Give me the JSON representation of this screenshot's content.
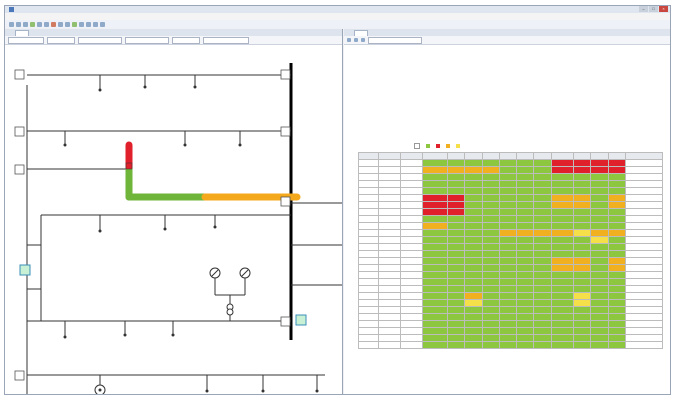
{
  "window": {
    "title": "",
    "buttons": [
      "–",
      "□",
      "×"
    ]
  },
  "menu": [],
  "colors": {
    "ok": "#8dc63f",
    "overload": "#e0202a",
    "warning": "#f5e04a",
    "caution": "#f0b020",
    "bus": "#000000",
    "highlight_green": "#6fb53a",
    "highlight_orange": "#f4a81c"
  },
  "left_panel": {
    "tab_label": "",
    "toolbar_combos": [
      "",
      "",
      "",
      "",
      "",
      ""
    ]
  },
  "right_panel": {
    "tab_label": "",
    "toolbar_combo": "",
    "settings_heading": "",
    "results_heading": "",
    "legend": [
      {
        "label": "",
        "color": "#ffffff"
      },
      {
        "label": "",
        "color": "#8dc63f"
      },
      {
        "label": "",
        "color": "#e0202a"
      },
      {
        "label": "",
        "color": "#f0b020"
      },
      {
        "label": "",
        "color": "#f5e04a"
      }
    ]
  },
  "table": {
    "columns": [
      "",
      "",
      "",
      "",
      "",
      "",
      "",
      "",
      "",
      "",
      "",
      "",
      "",
      "",
      "",
      ""
    ],
    "rows": [
      [
        "w",
        "w",
        "w",
        "g",
        "g",
        "g",
        "g",
        "g",
        "g",
        "g",
        "r",
        "r",
        "r",
        "r",
        "w"
      ],
      [
        "w",
        "w",
        "w",
        "o",
        "o",
        "o",
        "o",
        "g",
        "g",
        "g",
        "r",
        "r",
        "r",
        "r",
        "w"
      ],
      [
        "w",
        "w",
        "w",
        "g",
        "g",
        "g",
        "g",
        "g",
        "g",
        "g",
        "g",
        "g",
        "g",
        "g",
        "w"
      ],
      [
        "w",
        "w",
        "w",
        "g",
        "g",
        "g",
        "g",
        "g",
        "g",
        "g",
        "g",
        "g",
        "g",
        "g",
        "w"
      ],
      [
        "w",
        "w",
        "w",
        "g",
        "g",
        "g",
        "g",
        "g",
        "g",
        "g",
        "g",
        "g",
        "g",
        "g",
        "w"
      ],
      [
        "w",
        "w",
        "w",
        "r",
        "r",
        "g",
        "g",
        "g",
        "g",
        "g",
        "o",
        "o",
        "g",
        "o",
        "w"
      ],
      [
        "w",
        "w",
        "w",
        "r",
        "r",
        "g",
        "g",
        "g",
        "g",
        "g",
        "o",
        "o",
        "g",
        "o",
        "w"
      ],
      [
        "w",
        "w",
        "w",
        "r",
        "r",
        "g",
        "g",
        "g",
        "g",
        "g",
        "g",
        "g",
        "g",
        "g",
        "w"
      ],
      [
        "w",
        "w",
        "w",
        "g",
        "g",
        "g",
        "g",
        "g",
        "g",
        "g",
        "g",
        "g",
        "g",
        "g",
        "w"
      ],
      [
        "w",
        "w",
        "w",
        "o",
        "g",
        "g",
        "g",
        "g",
        "g",
        "g",
        "g",
        "g",
        "g",
        "g",
        "w"
      ],
      [
        "w",
        "w",
        "w",
        "g",
        "g",
        "g",
        "g",
        "o",
        "o",
        "o",
        "o",
        "y",
        "o",
        "o",
        "w"
      ],
      [
        "w",
        "w",
        "w",
        "g",
        "g",
        "g",
        "g",
        "g",
        "g",
        "g",
        "g",
        "g",
        "y",
        "g",
        "w"
      ],
      [
        "w",
        "w",
        "w",
        "g",
        "g",
        "g",
        "g",
        "g",
        "g",
        "g",
        "g",
        "g",
        "g",
        "g",
        "w"
      ],
      [
        "w",
        "w",
        "w",
        "g",
        "g",
        "g",
        "g",
        "g",
        "g",
        "g",
        "g",
        "g",
        "g",
        "g",
        "w"
      ],
      [
        "w",
        "w",
        "w",
        "g",
        "g",
        "g",
        "g",
        "g",
        "g",
        "g",
        "o",
        "o",
        "g",
        "o",
        "w"
      ],
      [
        "w",
        "w",
        "w",
        "g",
        "g",
        "g",
        "g",
        "g",
        "g",
        "g",
        "o",
        "o",
        "g",
        "o",
        "w"
      ],
      [
        "w",
        "w",
        "w",
        "g",
        "g",
        "g",
        "g",
        "g",
        "g",
        "g",
        "g",
        "g",
        "g",
        "g",
        "w"
      ],
      [
        "w",
        "w",
        "w",
        "g",
        "g",
        "g",
        "g",
        "g",
        "g",
        "g",
        "g",
        "g",
        "g",
        "g",
        "w"
      ],
      [
        "w",
        "w",
        "w",
        "g",
        "g",
        "g",
        "g",
        "g",
        "g",
        "g",
        "g",
        "g",
        "g",
        "g",
        "w"
      ],
      [
        "w",
        "w",
        "w",
        "g",
        "g",
        "o",
        "g",
        "g",
        "g",
        "g",
        "g",
        "y",
        "g",
        "g",
        "w"
      ],
      [
        "w",
        "w",
        "w",
        "g",
        "g",
        "y",
        "g",
        "g",
        "g",
        "g",
        "g",
        "y",
        "g",
        "g",
        "w"
      ],
      [
        "w",
        "w",
        "w",
        "g",
        "g",
        "g",
        "g",
        "g",
        "g",
        "g",
        "g",
        "g",
        "g",
        "g",
        "w"
      ],
      [
        "w",
        "w",
        "w",
        "g",
        "g",
        "g",
        "g",
        "g",
        "g",
        "g",
        "g",
        "g",
        "g",
        "g",
        "w"
      ],
      [
        "w",
        "w",
        "w",
        "g",
        "g",
        "g",
        "g",
        "g",
        "g",
        "g",
        "g",
        "g",
        "g",
        "g",
        "w"
      ],
      [
        "w",
        "w",
        "w",
        "g",
        "g",
        "g",
        "g",
        "g",
        "g",
        "g",
        "g",
        "g",
        "g",
        "g",
        "w"
      ],
      [
        "w",
        "w",
        "w",
        "g",
        "g",
        "g",
        "g",
        "g",
        "g",
        "g",
        "g",
        "g",
        "g",
        "g",
        "w"
      ],
      [
        "w",
        "w",
        "w",
        "g",
        "g",
        "g",
        "g",
        "g",
        "g",
        "g",
        "g",
        "g",
        "g",
        "g",
        "w"
      ]
    ]
  }
}
